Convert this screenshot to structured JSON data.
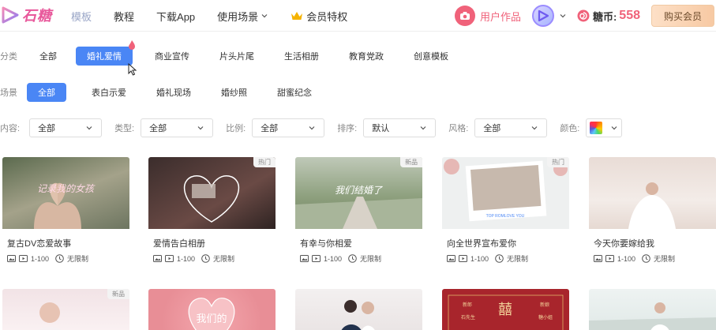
{
  "header": {
    "logo_text": "石糖",
    "nav": [
      {
        "label": "模板"
      },
      {
        "label": "教程"
      },
      {
        "label": "下载App"
      },
      {
        "label": "使用场景"
      },
      {
        "label": "会员特权"
      }
    ],
    "works_label": "用户作品",
    "sugar_label": "糖币:",
    "sugar_count": "558",
    "buy_label": "购买会员"
  },
  "filters": {
    "category_label": "分类",
    "categories": [
      "全部",
      "婚礼爱情",
      "商业宣传",
      "片头片尾",
      "生活相册",
      "教育党政",
      "创意模板"
    ],
    "scene_label": "场景",
    "scenes": [
      "全部",
      "表白示爱",
      "婚礼现场",
      "婚纱照",
      "甜蜜纪念"
    ],
    "selects": [
      {
        "label": "内容:",
        "value": "全部"
      },
      {
        "label": "类型:",
        "value": "全部"
      },
      {
        "label": "比例:",
        "value": "全部"
      },
      {
        "label": "排序:",
        "value": "默认"
      },
      {
        "label": "风格:",
        "value": "全部"
      }
    ],
    "color_label": "颜色:"
  },
  "cards": [
    {
      "title": "复古DV恋爱故事",
      "badge": "",
      "pages": "1-100",
      "duration": "无限制",
      "thumb_text": "记录我的女孩"
    },
    {
      "title": "爱情告白相册",
      "badge": "热门",
      "pages": "1-100",
      "duration": "无限制",
      "thumb_text": ""
    },
    {
      "title": "有幸与你相爱",
      "badge": "新品",
      "pages": "1-100",
      "duration": "无限制",
      "thumb_text": "我们结婚了"
    },
    {
      "title": "向全世界宣布爱你",
      "badge": "热门",
      "pages": "1-100",
      "duration": "无限制",
      "thumb_text": "TOP ROMLOVE YOU"
    },
    {
      "title": "今天你要嫁给我",
      "badge": "",
      "pages": "1-100",
      "duration": "无限制",
      "thumb_text": ""
    }
  ],
  "bottom_cards": [
    {
      "badge": "新品",
      "thumb_text": ""
    },
    {
      "badge": "",
      "thumb_text": "我们的"
    },
    {
      "badge": "",
      "thumb_text": ""
    },
    {
      "badge": "",
      "thumb_text": "囍"
    },
    {
      "badge": "",
      "thumb_text": ""
    }
  ],
  "bottom_card_texts": {
    "left_name": "新郎",
    "right_name": "新娘",
    "left_sub": "石先生",
    "right_sub": "糖小姐"
  },
  "colors": {
    "accent": "#4a86f5",
    "brand": "#f0627a"
  }
}
